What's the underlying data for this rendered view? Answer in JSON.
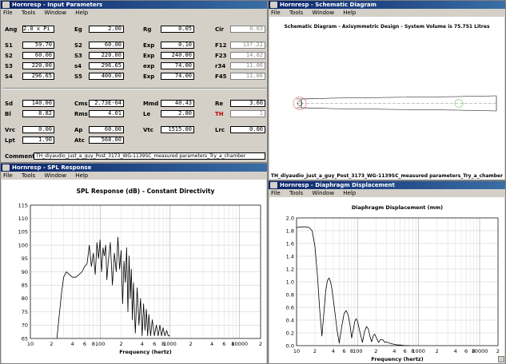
{
  "windows": {
    "input": {
      "title": "Hornresp - Input Parameters",
      "menu": [
        "File",
        "Tools",
        "Window",
        "Help"
      ],
      "comment_label": "Comment",
      "comment": "TH_diyaudio_just_a_guy_Post_3173_WG-1139SC_measured parameters_Try_a_chamber"
    },
    "schematic": {
      "title": "Hornresp - Schematic Diagram",
      "menu": [
        "File",
        "Tools",
        "Window",
        "Help"
      ],
      "heading": "Schematic Diagram - Axisymmetric Design - System Volume is 75.751 Litres",
      "caption": "TH_diyaudio_just_a_guy_Post_3173_WG-1139SC_measured parameters_Try_a_chamber"
    },
    "spl": {
      "title": "Hornresp - SPL Response",
      "menu": [
        "File",
        "Tools",
        "Window",
        "Help"
      ]
    },
    "disp": {
      "title": "Hornresp - Diaphragm Displacement",
      "menu": [
        "File",
        "Tools",
        "Window",
        "Help"
      ]
    }
  },
  "params": [
    {
      "id": "ang",
      "label": "Ang",
      "value": "2.0 x Pi"
    },
    {
      "id": "eg",
      "label": "Eg",
      "value": "2.00"
    },
    {
      "id": "rg",
      "label": "Rg",
      "value": "0.05"
    },
    {
      "id": "cir",
      "label": "Cir",
      "value": "0.03",
      "readonly": true
    },
    {
      "id": "s1",
      "label": "S1",
      "value": "59.70"
    },
    {
      "id": "s2",
      "label": "S2",
      "value": "60.00"
    },
    {
      "id": "exp1",
      "label": "Exp",
      "value": "0.10"
    },
    {
      "id": "f12",
      "label": "F12",
      "value": "137.22",
      "readonly": true
    },
    {
      "id": "s2b",
      "label": "S2",
      "value": "60.00"
    },
    {
      "id": "s3a",
      "label": "S3",
      "value": "220.00"
    },
    {
      "id": "exp2",
      "label": "Exp",
      "value": "240.00"
    },
    {
      "id": "f23",
      "label": "F23",
      "value": "14.82",
      "readonly": true
    },
    {
      "id": "s3b",
      "label": "S3",
      "value": "220.00"
    },
    {
      "id": "s4a",
      "label": "s4",
      "value": "296.65"
    },
    {
      "id": "exp3",
      "label": "exp",
      "value": "74.00"
    },
    {
      "id": "r34",
      "label": "r34",
      "value": "11.06",
      "readonly": true
    },
    {
      "id": "s4b",
      "label": "S4",
      "value": "296.65"
    },
    {
      "id": "s5",
      "label": "S5",
      "value": "400.00"
    },
    {
      "id": "exp4",
      "label": "Exp",
      "value": "74.00"
    },
    {
      "id": "f45",
      "label": "F45",
      "value": "11.06",
      "readonly": true
    },
    {
      "id": "sd",
      "label": "Sd",
      "value": "140.00"
    },
    {
      "id": "cms",
      "label": "Cms",
      "value": "2.73E-04"
    },
    {
      "id": "mmd",
      "label": "Mmd",
      "value": "40.43"
    },
    {
      "id": "re",
      "label": "Re",
      "value": "3.60"
    },
    {
      "id": "bl",
      "label": "Bl",
      "value": "8.82"
    },
    {
      "id": "rms",
      "label": "Rms",
      "value": "4.01"
    },
    {
      "id": "le",
      "label": "Le",
      "value": "2.80"
    },
    {
      "id": "th",
      "label": "TH",
      "value": "1",
      "readonly": true
    },
    {
      "id": "vrc",
      "label": "Vrc",
      "value": "0.00"
    },
    {
      "id": "ap",
      "label": "Ap",
      "value": "60.00"
    },
    {
      "id": "vtc",
      "label": "Vtc",
      "value": "1515.00"
    },
    {
      "id": "lrc",
      "label": "Lrc",
      "value": "0.00"
    },
    {
      "id": "lpt",
      "label": "Lpt",
      "value": "1.90"
    },
    {
      "id": "atc",
      "label": "Atc",
      "value": "568.00"
    }
  ],
  "chart_data": [
    {
      "type": "line",
      "title": "SPL Response (dB) - Constant Directivity",
      "xlabel": "Frequency (hertz)",
      "ylabel": "",
      "x_scale": "log",
      "xlim": [
        10,
        20000
      ],
      "ylim": [
        65,
        115
      ],
      "x_ticks": [
        10,
        20,
        40,
        60,
        80,
        100,
        200,
        400,
        600,
        800,
        1000,
        2000,
        4000,
        6000,
        8000,
        10000,
        20000
      ],
      "x_tick_labels": [
        "10",
        "2",
        "4",
        "6",
        "8",
        "100",
        "2",
        "4",
        "6",
        "8",
        "1000",
        "2",
        "4",
        "6",
        "8",
        "10000",
        "2"
      ],
      "y_ticks": [
        65,
        70,
        75,
        80,
        85,
        90,
        95,
        100,
        105,
        110,
        115
      ],
      "grid": true,
      "series": [
        {
          "color": "#000000",
          "x": [
            24,
            26,
            28,
            30,
            33,
            36,
            40,
            45,
            50,
            55,
            60,
            65,
            70,
            75,
            80,
            85,
            90,
            95,
            100,
            105,
            110,
            115,
            120,
            125,
            130,
            140,
            150,
            160,
            170,
            180,
            190,
            200,
            210,
            220,
            230,
            240,
            250,
            260,
            270,
            280,
            290,
            300,
            320,
            340,
            360,
            380,
            400,
            420,
            440,
            460,
            480,
            500,
            530,
            560,
            600,
            640,
            680,
            720,
            760,
            800,
            850,
            900,
            950,
            1000
          ],
          "y": [
            65,
            74,
            82,
            88,
            90,
            89,
            88,
            88,
            89,
            90,
            92,
            93,
            100,
            92,
            97,
            89,
            101,
            95,
            102,
            90,
            99,
            96,
            100,
            87,
            93,
            101,
            85,
            97,
            90,
            103,
            91,
            98,
            78,
            94,
            86,
            99,
            75,
            96,
            80,
            91,
            72,
            86,
            67,
            84,
            70,
            80,
            66,
            78,
            68,
            76,
            66,
            74,
            66,
            72,
            66,
            70,
            66,
            70,
            66,
            69,
            66,
            68,
            66,
            66
          ]
        }
      ]
    },
    {
      "type": "line",
      "title": "Diaphragm Displacement (mm)",
      "xlabel": "Frequency (hertz)",
      "ylabel": "",
      "x_scale": "log",
      "xlim": [
        10,
        20000
      ],
      "ylim": [
        0,
        2.0
      ],
      "x_ticks": [
        10,
        20,
        40,
        60,
        80,
        100,
        200,
        400,
        600,
        800,
        1000,
        2000,
        4000,
        6000,
        8000,
        10000,
        20000
      ],
      "x_tick_labels": [
        "10",
        "2",
        "4",
        "6",
        "8",
        "100",
        "2",
        "4",
        "6",
        "8",
        "1000",
        "2",
        "4",
        "6",
        "8",
        "10000",
        "2"
      ],
      "y_ticks": [
        0,
        0.2,
        0.4,
        0.6,
        0.8,
        1.0,
        1.2,
        1.4,
        1.6,
        1.8,
        2.0
      ],
      "y_tick_labels": [
        "0.0",
        "0.2",
        "0.4",
        "0.6",
        "0.8",
        "1.0",
        "1.2",
        "1.4",
        "1.6",
        "1.8",
        "2.0"
      ],
      "grid": true,
      "series": [
        {
          "color": "#000000",
          "x": [
            10,
            12,
            14,
            16,
            18,
            20,
            22,
            24,
            26,
            28,
            30,
            32,
            34,
            36,
            38,
            40,
            43,
            46,
            50,
            55,
            60,
            65,
            70,
            75,
            80,
            85,
            90,
            95,
            100,
            110,
            120,
            130,
            140,
            150,
            160,
            170,
            180,
            190,
            200,
            220,
            240,
            260,
            280,
            300,
            330,
            360,
            400,
            450,
            500,
            600,
            700
          ],
          "y": [
            1.85,
            1.86,
            1.86,
            1.85,
            1.8,
            1.55,
            1.1,
            0.55,
            0.15,
            0.5,
            0.85,
            1.02,
            1.06,
            1.0,
            0.88,
            0.72,
            0.48,
            0.25,
            0.04,
            0.3,
            0.5,
            0.55,
            0.48,
            0.33,
            0.12,
            0.25,
            0.38,
            0.42,
            0.38,
            0.2,
            0.05,
            0.22,
            0.3,
            0.26,
            0.14,
            0.06,
            0.15,
            0.18,
            0.14,
            0.05,
            0.1,
            0.09,
            0.05,
            0.06,
            0.04,
            0.03,
            0.02,
            0.01,
            0.01,
            0.0,
            0.0
          ]
        }
      ]
    }
  ]
}
